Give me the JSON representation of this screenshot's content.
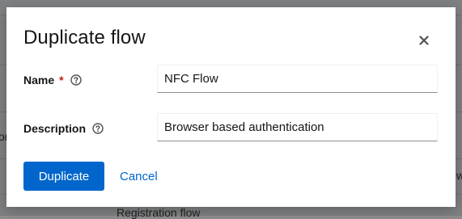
{
  "background": {
    "partial_text_left": "or",
    "partial_text_right": "w",
    "registration_flow": "Registration flow"
  },
  "modal": {
    "title": "Duplicate flow",
    "close_icon": "close-icon",
    "name": {
      "label": "Name",
      "required_mark": "*",
      "help_icon": "help-icon",
      "value": "NFC Flow"
    },
    "description": {
      "label": "Description",
      "help_icon": "help-icon",
      "value": "Browser based authentication"
    },
    "actions": {
      "primary_label": "Duplicate",
      "cancel_label": "Cancel"
    }
  },
  "colors": {
    "primary": "#0066cc",
    "required": "#c9190b"
  }
}
